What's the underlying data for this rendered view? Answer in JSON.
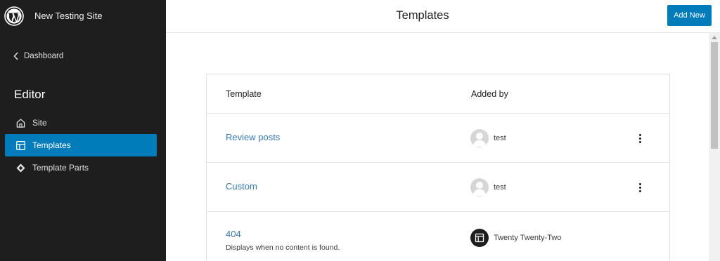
{
  "site": {
    "title": "New Testing Site"
  },
  "sidebar": {
    "back_label": "Dashboard",
    "heading": "Editor",
    "items": [
      {
        "label": "Site",
        "icon": "home-icon",
        "active": false
      },
      {
        "label": "Templates",
        "icon": "layout-icon",
        "active": true
      },
      {
        "label": "Template Parts",
        "icon": "symbol-filled-icon",
        "active": false
      }
    ]
  },
  "header": {
    "title": "Templates",
    "add_new_label": "Add New"
  },
  "table": {
    "columns": [
      "Template",
      "Added by"
    ],
    "rows": [
      {
        "name": "Review posts",
        "description": "",
        "author": "test",
        "author_type": "user"
      },
      {
        "name": "Custom",
        "description": "",
        "author": "test",
        "author_type": "user"
      },
      {
        "name": "404",
        "description": "Displays when no content is found.",
        "author": "Twenty Twenty-Two",
        "author_type": "theme"
      }
    ]
  },
  "colors": {
    "accent": "#007cba",
    "sidebar_bg": "#1e1e1e",
    "link": "#3a78b0"
  }
}
